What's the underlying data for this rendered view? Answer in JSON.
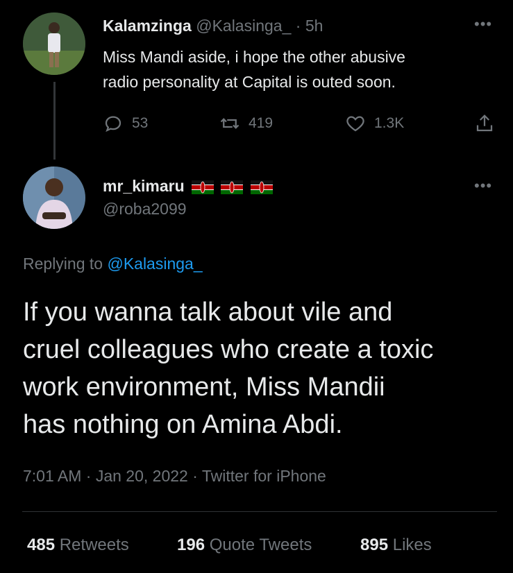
{
  "parent_tweet": {
    "display_name": "Kalamzinga",
    "handle": "@Kalasinga_",
    "separator": "·",
    "time": "5h",
    "text_line1": "Miss Mandi aside, i hope the other abusive",
    "text_line2": "radio personality at Capital is outed soon.",
    "replies": "53",
    "retweets": "419",
    "likes": "1.3K"
  },
  "main_tweet": {
    "display_name": "mr_kimaru",
    "handle": "@roba2099",
    "flag_icons": [
      "kenya-flag-icon",
      "kenya-flag-icon",
      "kenya-flag-icon"
    ],
    "replying_prefix": "Replying to",
    "replying_handle": "@Kalasinga_",
    "text_line1": "If you wanna talk about vile and",
    "text_line2": "cruel colleagues who create a toxic",
    "text_line3": "work environment, Miss Mandii",
    "text_line4": "has nothing on Amina Abdi.",
    "timestamp": "7:01 AM · Jan 20, 2022 · Twitter for iPhone",
    "retweets_count": "485",
    "retweets_label": "Retweets",
    "quotes_count": "196",
    "quotes_label": "Quote Tweets",
    "likes_count": "895",
    "likes_label": "Likes"
  },
  "colors": {
    "background": "#000000",
    "text": "#e7e9ea",
    "muted": "#71767b",
    "link": "#1d9bf0",
    "flag_green": "#006600",
    "flag_red": "#bb0000"
  }
}
